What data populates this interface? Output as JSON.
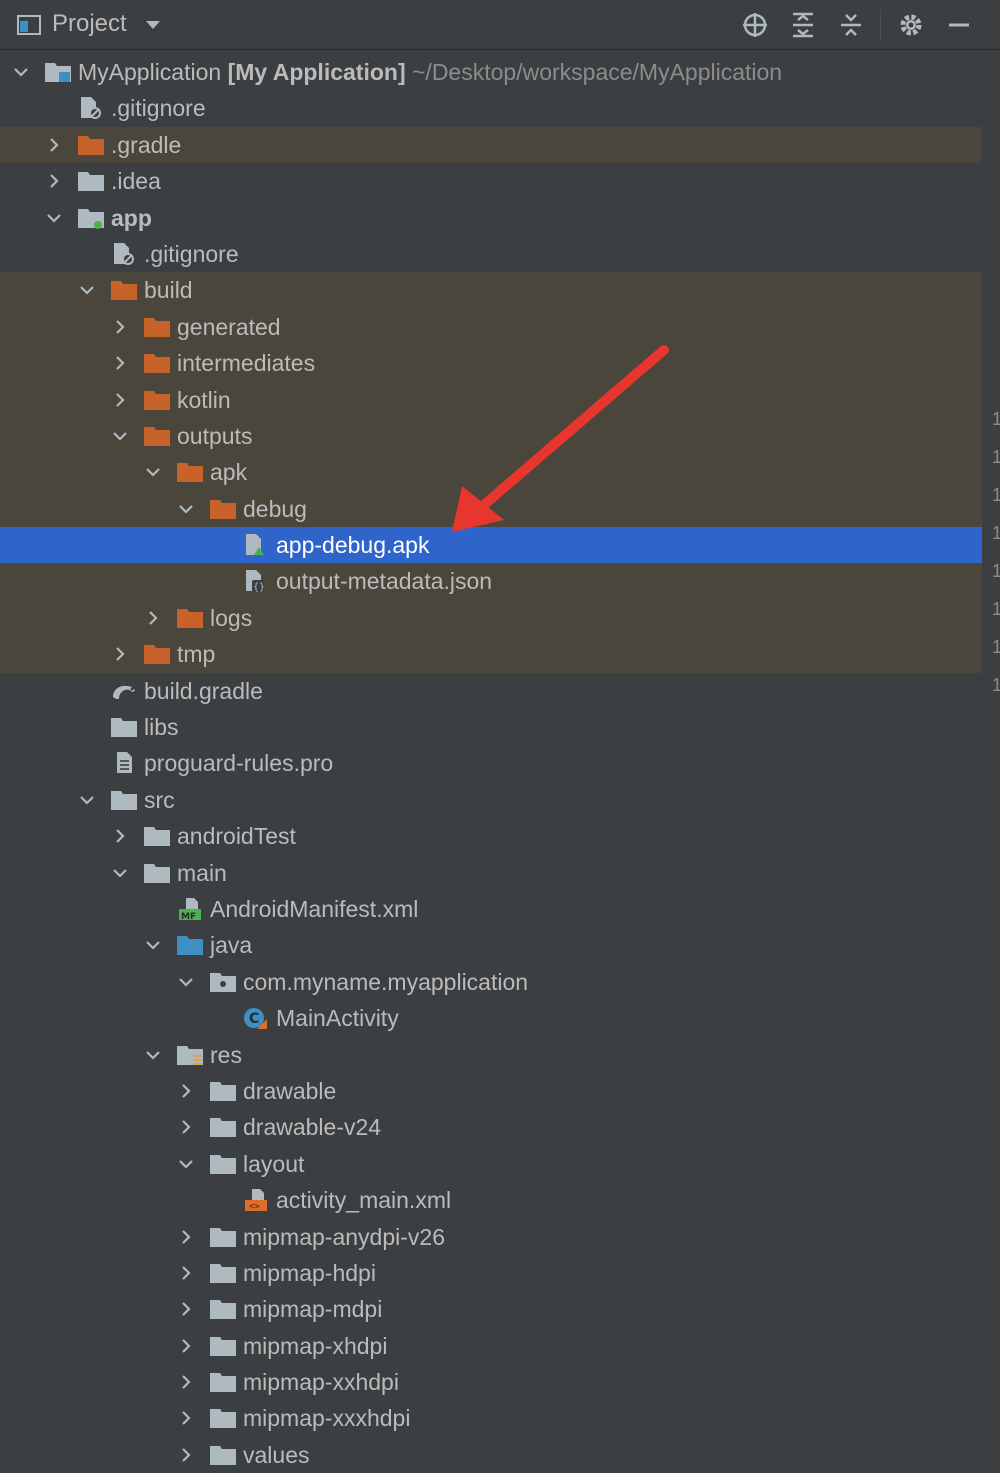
{
  "header": {
    "title": "Project",
    "actions": [
      "select-opened-file-icon",
      "expand-all-icon",
      "collapse-all-icon",
      "gear-icon",
      "hide-icon"
    ]
  },
  "tree": [
    {
      "label": "MyApplication",
      "module": "[My Application]",
      "path": "~/Desktop/workspace/MyApplication",
      "depth": 0,
      "expanded": true,
      "icon": "module-folder-icon"
    },
    {
      "label": ".gitignore",
      "depth": 1,
      "icon": "ignore-file-icon"
    },
    {
      "label": ".gradle",
      "depth": 1,
      "expanded": false,
      "icon": "folder-excluded-icon",
      "excluded": true
    },
    {
      "label": ".idea",
      "depth": 1,
      "expanded": false,
      "icon": "folder-icon"
    },
    {
      "label": "app",
      "depth": 1,
      "expanded": true,
      "icon": "app-module-icon",
      "bold": true
    },
    {
      "label": ".gitignore",
      "depth": 2,
      "icon": "ignore-file-icon"
    },
    {
      "label": "build",
      "depth": 2,
      "expanded": true,
      "icon": "folder-excluded-icon",
      "excluded": true
    },
    {
      "label": "generated",
      "depth": 3,
      "expanded": false,
      "icon": "folder-excluded-icon",
      "excluded": true
    },
    {
      "label": "intermediates",
      "depth": 3,
      "expanded": false,
      "icon": "folder-excluded-icon",
      "excluded": true
    },
    {
      "label": "kotlin",
      "depth": 3,
      "expanded": false,
      "icon": "folder-excluded-icon",
      "excluded": true
    },
    {
      "label": "outputs",
      "depth": 3,
      "expanded": true,
      "icon": "folder-excluded-icon",
      "excluded": true
    },
    {
      "label": "apk",
      "depth": 4,
      "expanded": true,
      "icon": "folder-excluded-icon",
      "excluded": true
    },
    {
      "label": "debug",
      "depth": 5,
      "expanded": true,
      "icon": "folder-excluded-icon",
      "excluded": true
    },
    {
      "label": "app-debug.apk",
      "depth": 6,
      "icon": "apk-file-icon",
      "selected": true
    },
    {
      "label": "output-metadata.json",
      "depth": 6,
      "icon": "json-file-icon",
      "excluded": true
    },
    {
      "label": "logs",
      "depth": 4,
      "expanded": false,
      "icon": "folder-excluded-icon",
      "excluded": true
    },
    {
      "label": "tmp",
      "depth": 3,
      "expanded": false,
      "icon": "folder-excluded-icon",
      "excluded": true
    },
    {
      "label": "build.gradle",
      "depth": 2,
      "icon": "gradle-file-icon"
    },
    {
      "label": "libs",
      "depth": 2,
      "icon": "folder-icon"
    },
    {
      "label": "proguard-rules.pro",
      "depth": 2,
      "icon": "text-file-icon"
    },
    {
      "label": "src",
      "depth": 2,
      "expanded": true,
      "icon": "folder-icon"
    },
    {
      "label": "androidTest",
      "depth": 3,
      "expanded": false,
      "icon": "folder-icon"
    },
    {
      "label": "main",
      "depth": 3,
      "expanded": true,
      "icon": "folder-icon"
    },
    {
      "label": "AndroidManifest.xml",
      "depth": 4,
      "icon": "manifest-file-icon"
    },
    {
      "label": "java",
      "depth": 4,
      "expanded": true,
      "icon": "source-folder-icon"
    },
    {
      "label": "com.myname.myapplication",
      "depth": 5,
      "expanded": true,
      "icon": "package-icon"
    },
    {
      "label": "MainActivity",
      "depth": 6,
      "icon": "kotlin-class-icon"
    },
    {
      "label": "res",
      "depth": 4,
      "expanded": true,
      "icon": "resource-folder-icon"
    },
    {
      "label": "drawable",
      "depth": 5,
      "expanded": false,
      "icon": "folder-icon"
    },
    {
      "label": "drawable-v24",
      "depth": 5,
      "expanded": false,
      "icon": "folder-icon"
    },
    {
      "label": "layout",
      "depth": 5,
      "expanded": true,
      "icon": "folder-icon"
    },
    {
      "label": "activity_main.xml",
      "depth": 6,
      "icon": "layout-xml-icon"
    },
    {
      "label": "mipmap-anydpi-v26",
      "depth": 5,
      "expanded": false,
      "icon": "folder-icon"
    },
    {
      "label": "mipmap-hdpi",
      "depth": 5,
      "expanded": false,
      "icon": "folder-icon"
    },
    {
      "label": "mipmap-mdpi",
      "depth": 5,
      "expanded": false,
      "icon": "folder-icon"
    },
    {
      "label": "mipmap-xhdpi",
      "depth": 5,
      "expanded": false,
      "icon": "folder-icon"
    },
    {
      "label": "mipmap-xxhdpi",
      "depth": 5,
      "expanded": false,
      "icon": "folder-icon"
    },
    {
      "label": "mipmap-xxxhdpi",
      "depth": 5,
      "expanded": false,
      "icon": "folder-icon"
    },
    {
      "label": "values",
      "depth": 5,
      "expanded": false,
      "icon": "folder-icon"
    }
  ],
  "gutter": [
    "1",
    "1",
    "1",
    "1",
    "1",
    "1",
    "1",
    "1"
  ],
  "colors": {
    "background": "#3c3f41",
    "excluded_row": "#4a463c",
    "selection": "#2f65ca",
    "excluded_folder": "#c7622a",
    "folder": "#aeb9c0",
    "source_folder": "#3d8fc4",
    "annotation_arrow": "#e8352e",
    "text": "#bbbbbb",
    "path_text": "#8c8c8c"
  }
}
